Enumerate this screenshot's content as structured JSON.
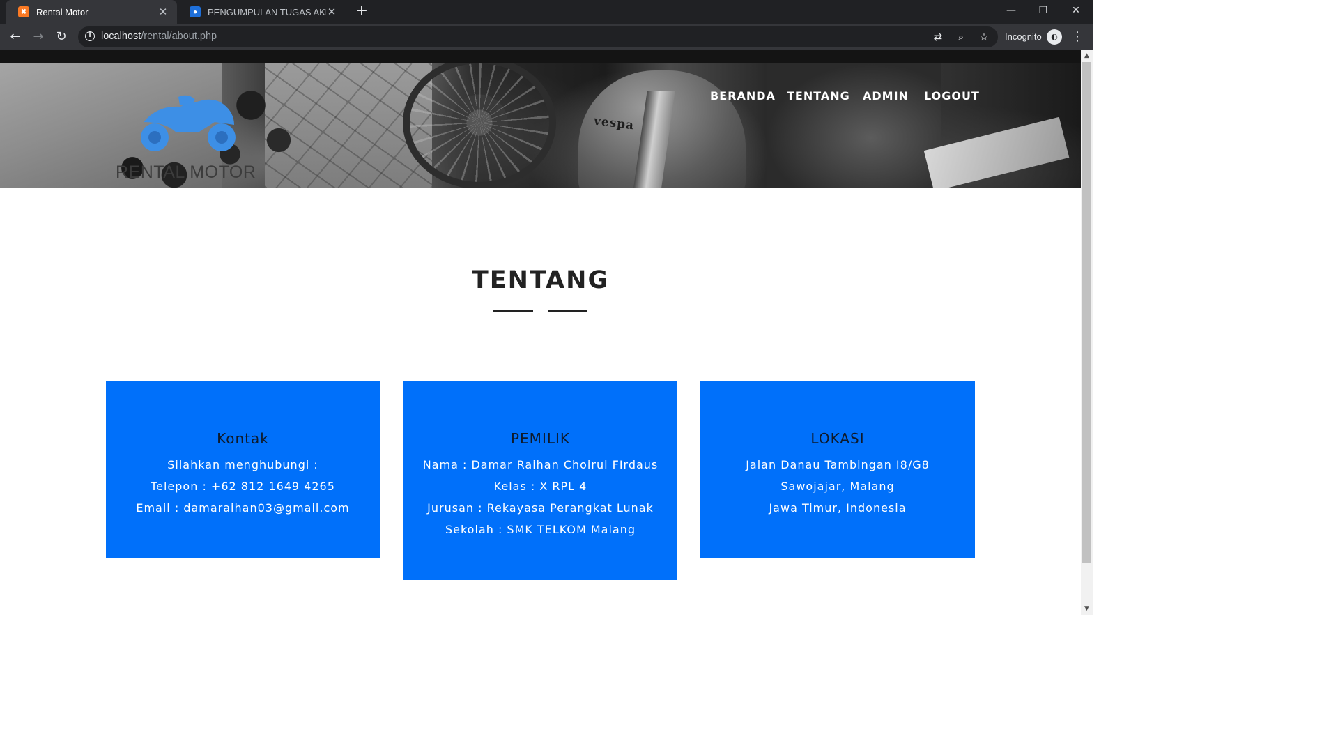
{
  "browser": {
    "tabs": [
      {
        "title": "Rental Motor",
        "active": true
      },
      {
        "title": "PENGUMPULAN TUGAS AKHIR W",
        "active": false
      }
    ],
    "new_tab_label": "+",
    "close_glyph": "✕",
    "window_controls": {
      "minimize": "—",
      "restore": "❐",
      "close": "✕"
    },
    "url": {
      "host": "localhost",
      "path": "/rental/about.php"
    },
    "incognito_label": "Incognito",
    "icons": [
      "back-icon",
      "forward-icon",
      "reload-icon",
      "info-icon",
      "translate-icon",
      "zoom-icon",
      "star-icon",
      "incognito-icon",
      "more-menu-icon"
    ]
  },
  "site": {
    "logo_text": "RENTAL MOTOR",
    "logo_color": "#3d8fe6",
    "hero_watermark": "vespa",
    "nav": [
      {
        "label": "BERANDA"
      },
      {
        "label": "TENTANG"
      },
      {
        "label": "ADMIN"
      },
      {
        "label": "LOGOUT"
      }
    ]
  },
  "about": {
    "title": "TENTANG",
    "cards": [
      {
        "title": "Kontak",
        "lines": [
          "Silahkan menghubungi :",
          "Telepon : +62 812 1649 4265",
          "Email : damaraihan03@gmail.com"
        ]
      },
      {
        "title": "PEMILIK",
        "lines": [
          "Nama : Damar Raihan Choirul FIrdaus",
          "Kelas : X RPL 4",
          "Jurusan : Rekayasa Perangkat Lunak",
          "Sekolah : SMK TELKOM Malang"
        ]
      },
      {
        "title": "LOKASI",
        "lines": [
          "Jalan Danau Tambingan I8/G8",
          "Sawojajar, Malang",
          "Jawa Timur, Indonesia"
        ]
      }
    ]
  },
  "colors": {
    "card_blue": "#0070fa",
    "chrome_dark": "#202124",
    "chrome_toolbar": "#35363a",
    "title_text": "#222222"
  }
}
